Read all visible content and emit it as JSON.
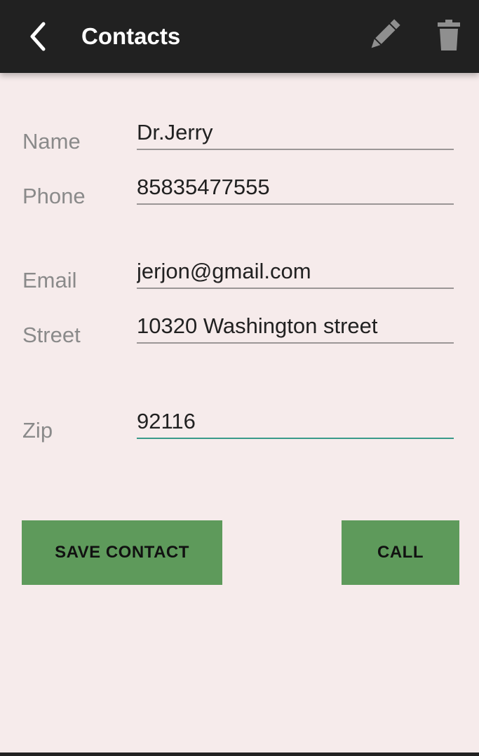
{
  "app_bar": {
    "title": "Contacts",
    "back_icon": "chevron-left-icon",
    "edit_icon": "pencil-icon",
    "delete_icon": "trash-icon"
  },
  "form": {
    "name": {
      "label": "Name",
      "value": "Dr.Jerry"
    },
    "phone": {
      "label": "Phone",
      "value": "85835477555"
    },
    "email": {
      "label": "Email",
      "value": "jerjon@gmail.com"
    },
    "street": {
      "label": "Street",
      "value": "10320 Washington street"
    },
    "zip": {
      "label": "Zip",
      "value": "92116"
    }
  },
  "actions": {
    "save_label": "SAVE CONTACT",
    "call_label": "CALL"
  },
  "colors": {
    "app_bar": "#212121",
    "background": "#f6ebeb",
    "button": "#5e9a5b",
    "focus_underline": "#3a9a8a"
  }
}
